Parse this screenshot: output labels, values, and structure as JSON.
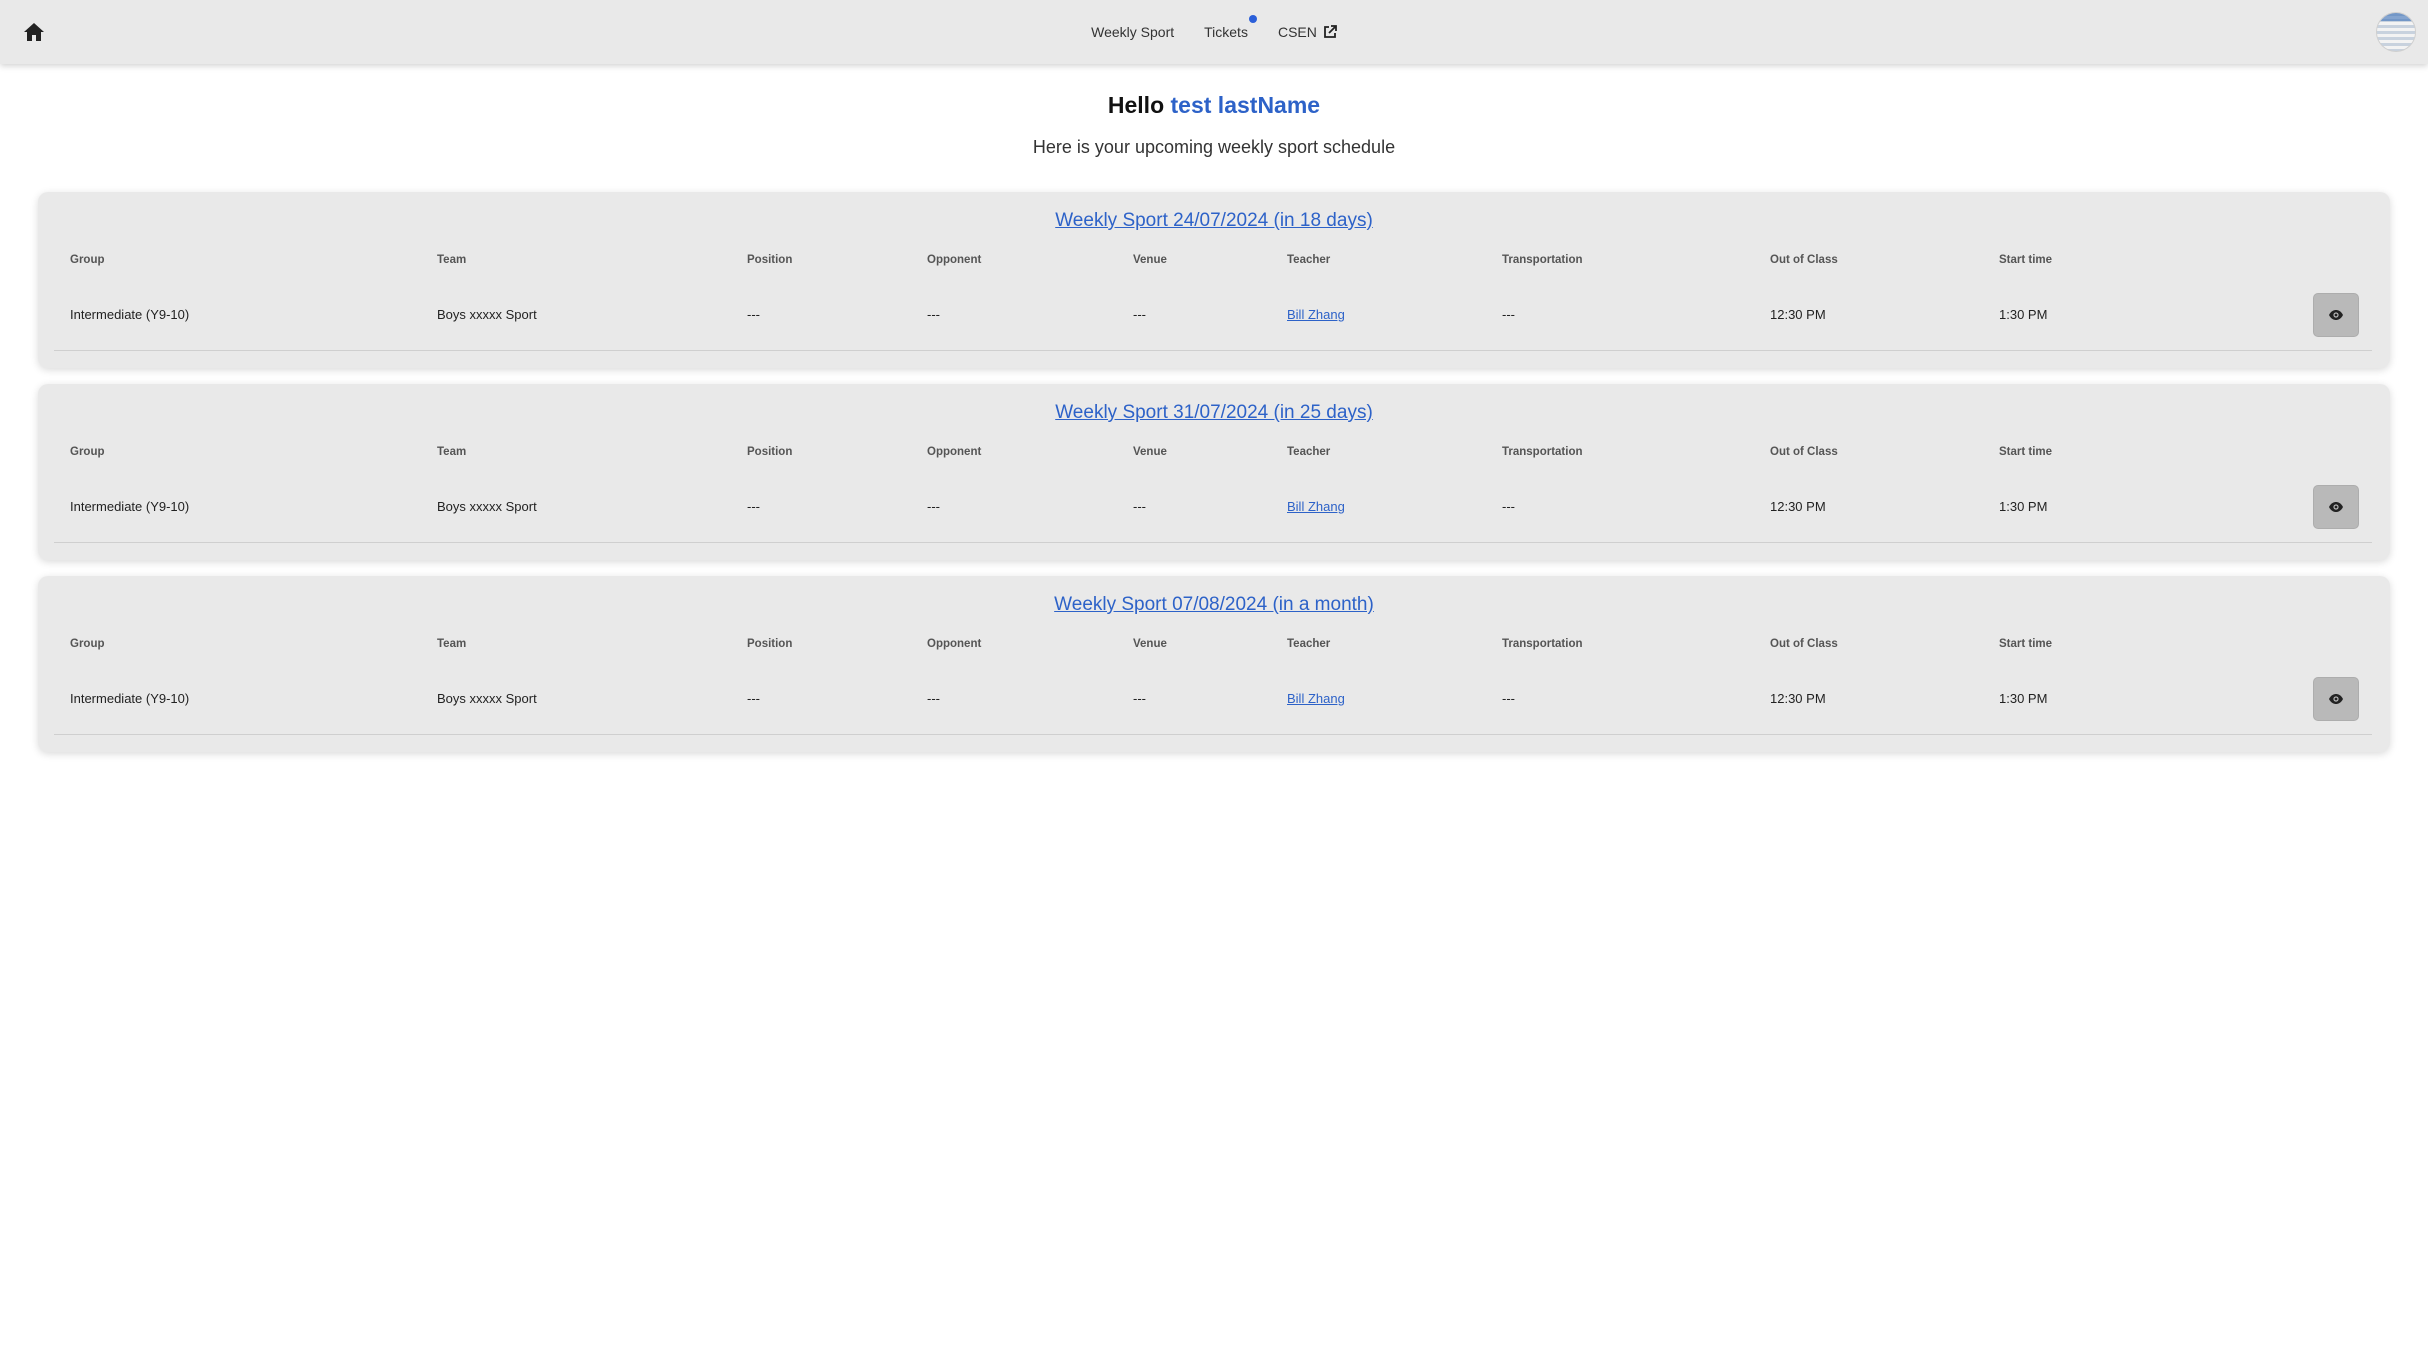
{
  "nav": {
    "home_icon": "home-icon",
    "links": [
      {
        "label": "Weekly Sport"
      },
      {
        "label": "Tickets"
      },
      {
        "label": "CSEN"
      }
    ]
  },
  "greeting": {
    "hello": "Hello",
    "name": "test lastName",
    "subtitle": "Here is your upcoming weekly sport schedule"
  },
  "columns": [
    "Group",
    "Team",
    "Position",
    "Opponent",
    "Venue",
    "Teacher",
    "Transportation",
    "Out of Class",
    "Start time"
  ],
  "schedules": [
    {
      "title": "Weekly Sport 24/07/2024 (in 18 days)",
      "row": {
        "group": "Intermediate (Y9-10)",
        "team": "Boys xxxxx Sport",
        "position": "---",
        "opponent": "---",
        "venue": "---",
        "teacher": "Bill Zhang",
        "transportation": "---",
        "out_of_class": "12:30 PM",
        "start_time": "1:30 PM"
      }
    },
    {
      "title": "Weekly Sport 31/07/2024 (in 25 days)",
      "row": {
        "group": "Intermediate (Y9-10)",
        "team": "Boys xxxxx Sport",
        "position": "---",
        "opponent": "---",
        "venue": "---",
        "teacher": "Bill Zhang",
        "transportation": "---",
        "out_of_class": "12:30 PM",
        "start_time": "1:30 PM"
      }
    },
    {
      "title": "Weekly Sport 07/08/2024 (in a month)",
      "row": {
        "group": "Intermediate (Y9-10)",
        "team": "Boys xxxxx Sport",
        "position": "---",
        "opponent": "---",
        "venue": "---",
        "teacher": "Bill Zhang",
        "transportation": "---",
        "out_of_class": "12:30 PM",
        "start_time": "1:30 PM"
      }
    }
  ],
  "colors": {
    "accent": "#2d62c8",
    "notification": "#2b5fd9",
    "card_bg": "#e9e9e9"
  }
}
